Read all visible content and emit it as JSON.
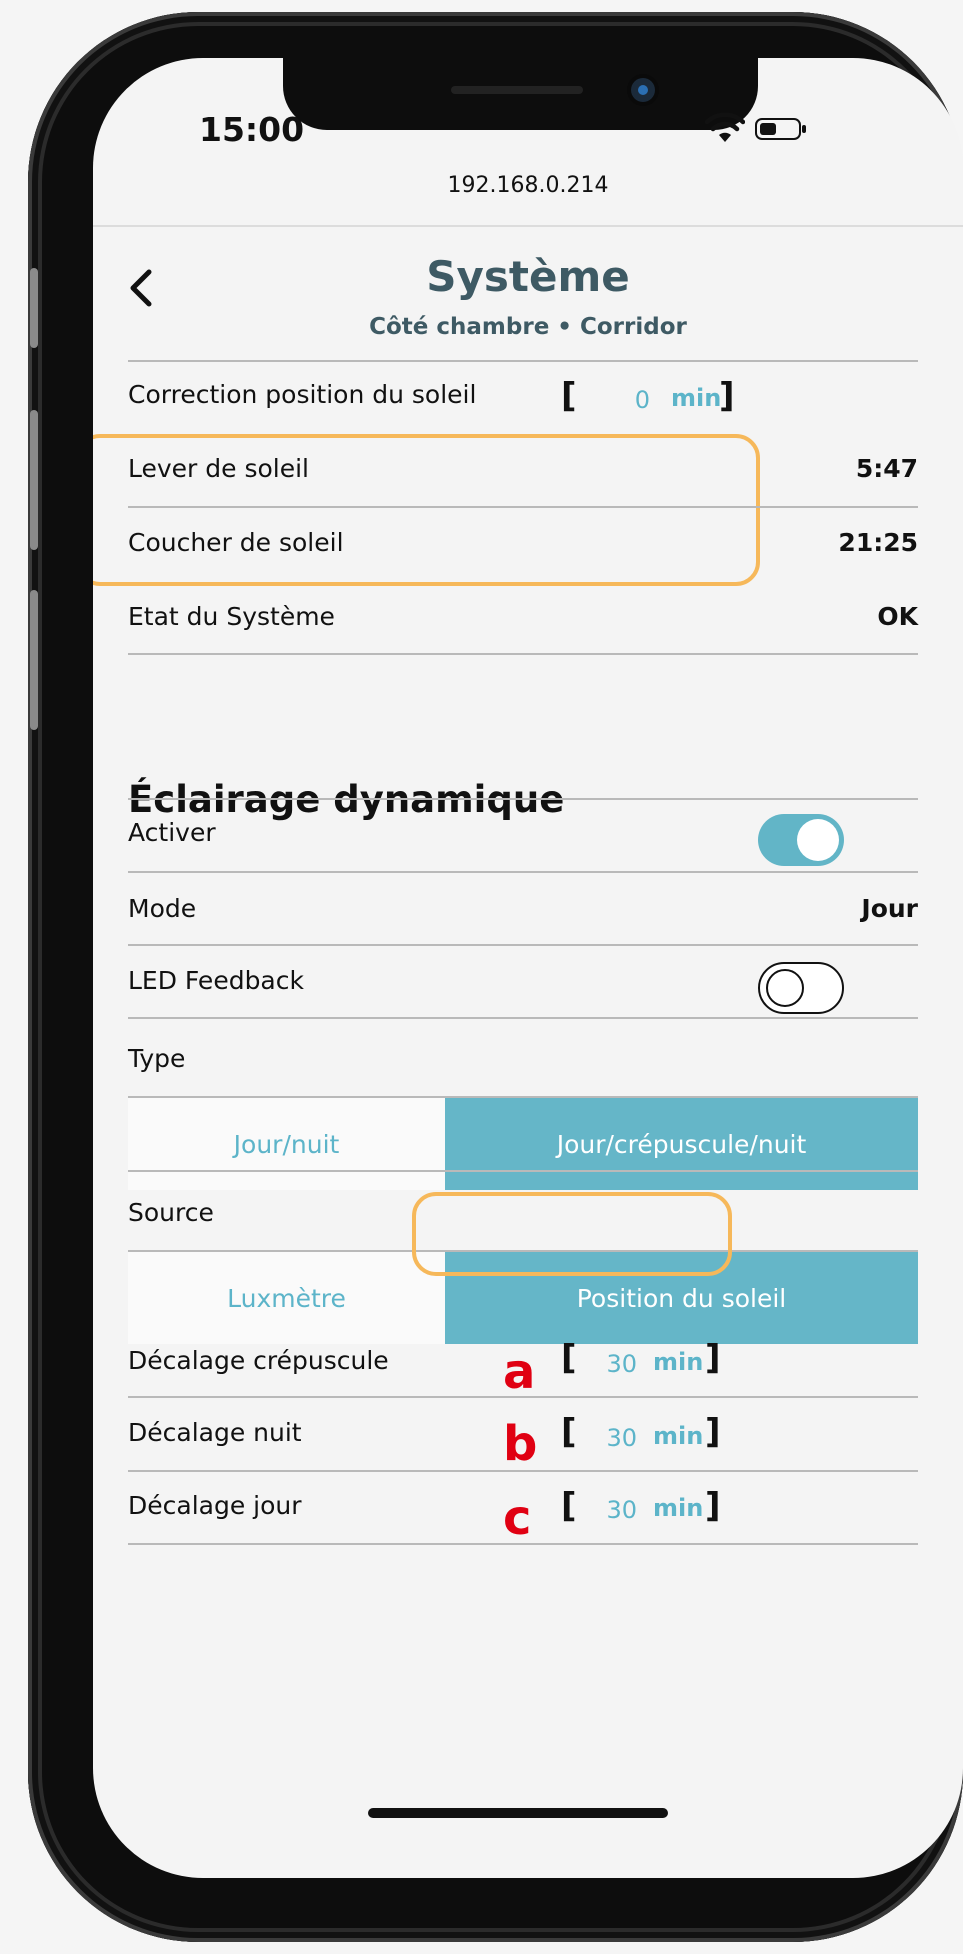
{
  "status_bar": {
    "time": "15:00"
  },
  "browser": {
    "url": "192.168.0.214"
  },
  "header": {
    "title": "Système",
    "subtitle": "Côté chambre • Corridor"
  },
  "system": {
    "correction": {
      "label": "Correction position du soleil",
      "value": "0",
      "unit": "min"
    },
    "sunrise": {
      "label": "Lever de soleil",
      "value": "5:47"
    },
    "sunset": {
      "label": "Coucher de soleil",
      "value": "21:25"
    },
    "state": {
      "label": "Etat du Système",
      "value": "OK"
    }
  },
  "dynamic_lighting": {
    "title": "Éclairage dynamique",
    "activate": {
      "label": "Activer",
      "on": true
    },
    "mode": {
      "label": "Mode",
      "value": "Jour"
    },
    "led_feedback": {
      "label": "LED Feedback",
      "on": false
    },
    "type": {
      "label": "Type",
      "options": [
        "Jour/nuit",
        "Jour/crépuscule/nuit"
      ],
      "selected": "Jour/crépuscule/nuit"
    },
    "source": {
      "label": "Source",
      "options": [
        "Luxmètre",
        "Position du soleil"
      ],
      "selected": "Position du soleil"
    },
    "offset_twilight": {
      "label": "Décalage crépuscule",
      "value": "30",
      "unit": "min",
      "marker": "a"
    },
    "offset_night": {
      "label": "Décalage nuit",
      "value": "30",
      "unit": "min",
      "marker": "b"
    },
    "offset_day": {
      "label": "Décalage jour",
      "value": "30",
      "unit": "min",
      "marker": "c"
    }
  },
  "colors": {
    "accent": "#62b5c7",
    "highlight": "#f6b85a",
    "marker": "#e00012",
    "title": "#3e5a64"
  }
}
